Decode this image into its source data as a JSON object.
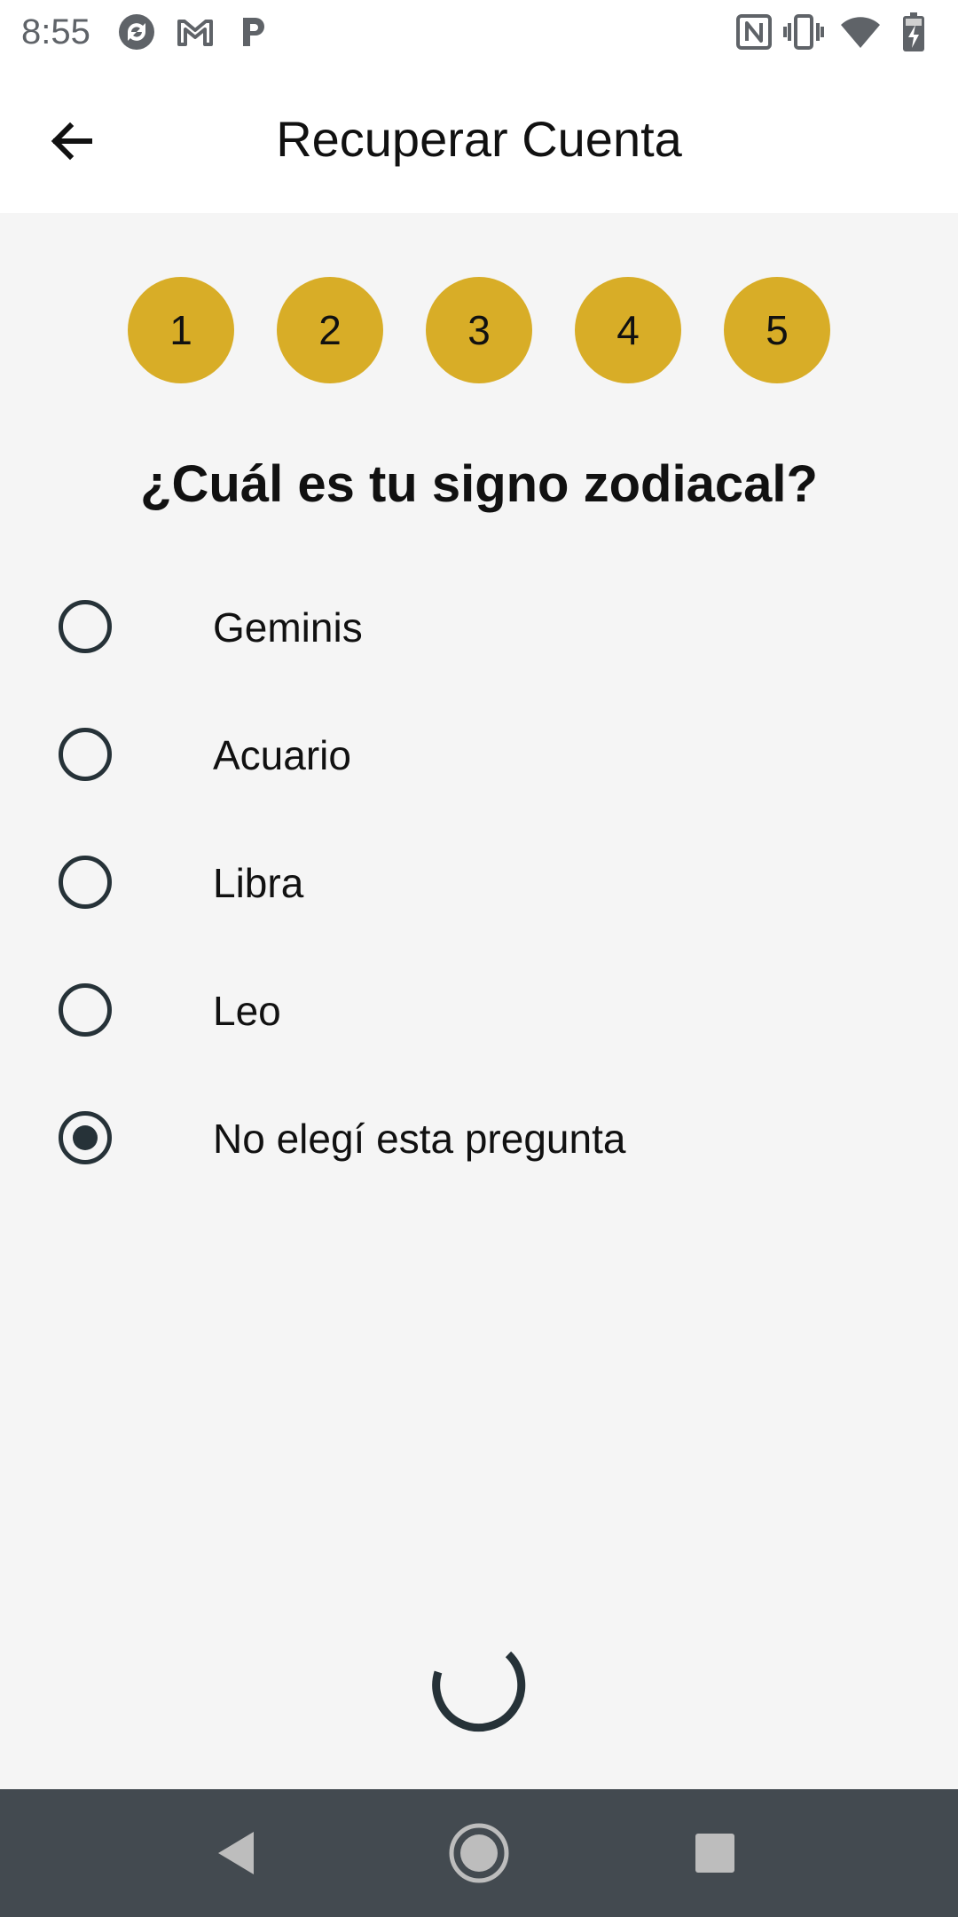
{
  "status_bar": {
    "time": "8:55",
    "left_icons": [
      "sync-app-icon",
      "gmail-icon",
      "pandora-icon"
    ],
    "right_icons": [
      "nfc-icon",
      "vibrate-icon",
      "wifi-icon",
      "battery-charging-icon"
    ]
  },
  "app_bar": {
    "title": "Recuperar Cuenta",
    "back_icon": "arrow-back-icon"
  },
  "steps": [
    "1",
    "2",
    "3",
    "4",
    "5"
  ],
  "question": "¿Cuál es tu signo zodiacal?",
  "options": [
    {
      "label": "Geminis",
      "selected": false
    },
    {
      "label": "Acuario",
      "selected": false
    },
    {
      "label": "Libra",
      "selected": false
    },
    {
      "label": "Leo",
      "selected": false
    },
    {
      "label": "No elegí esta pregunta",
      "selected": true
    }
  ],
  "loading": true,
  "colors": {
    "accent": "#d8ad27",
    "radio": "#263238",
    "background": "#f5f5f5",
    "nav_bar": "#434a50"
  },
  "nav_bar": {
    "icons": [
      "back-triangle-icon",
      "home-circle-icon",
      "recents-square-icon"
    ]
  }
}
